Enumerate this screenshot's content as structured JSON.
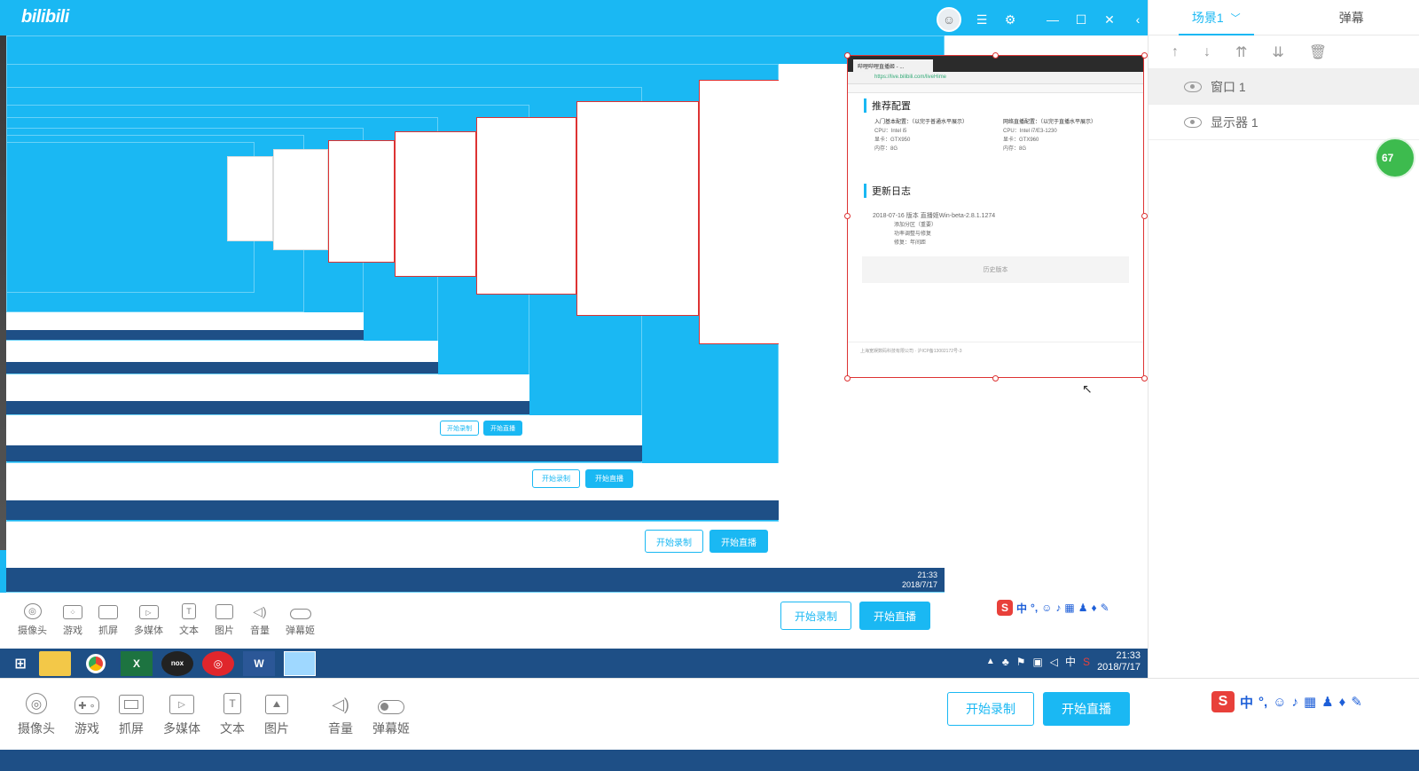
{
  "app": {
    "logo": "bilibili"
  },
  "titlebar": {
    "icons": [
      "avatar-icon",
      "menu-icon",
      "settings-icon",
      "minimize-icon",
      "maximize-icon",
      "close-icon",
      "collapse-icon"
    ]
  },
  "right_panel": {
    "tabs": [
      {
        "label": "场景1"
      },
      {
        "label": "弹幕"
      }
    ],
    "tools": [
      "move-up-icon",
      "move-down-icon",
      "move-top-icon",
      "move-bottom-icon",
      "delete-icon"
    ],
    "sources": [
      {
        "label": "窗口 1"
      },
      {
        "label": "显示器 1"
      }
    ],
    "badge": "67"
  },
  "toolbar": {
    "sources": [
      {
        "label": "摄像头",
        "icon": "camera-icon"
      },
      {
        "label": "游戏",
        "icon": "gamepad-icon"
      },
      {
        "label": "抓屏",
        "icon": "screen-capture-icon"
      },
      {
        "label": "多媒体",
        "icon": "media-icon"
      },
      {
        "label": "文本",
        "icon": "text-icon"
      },
      {
        "label": "图片",
        "icon": "image-icon"
      },
      {
        "label": "音量",
        "icon": "volume-icon"
      },
      {
        "label": "弹幕姬",
        "icon": "danmaku-toggle-icon"
      }
    ],
    "record_label": "开始录制",
    "live_label": "开始直播"
  },
  "nested_taskbar": {
    "time": "21:33",
    "date": "2018/7/17",
    "ime_lang": "中"
  },
  "browser_capture": {
    "tab_title": "哔哩哔哩直播姬 - ...",
    "url": "https://live.bilibili.com/liveHime",
    "section1": "推荐配置",
    "entry_label": "入门基本配置：（以完于普通水平展示）",
    "pro_label": "网络直播配置：（以完于直播水平展示）",
    "spec_left": [
      "CPU：Intel i5",
      "显卡：GTX950",
      "内存：8G"
    ],
    "spec_right": [
      "CPU：Intel i7/E3-1230",
      "显卡：GTX960",
      "内存：8G"
    ],
    "section2": "更新日志",
    "log_line": "2018-07-16 版本 直播姬Win-beta-2.8.1.1274",
    "log_items": [
      "添加分区（重要）",
      "功率调整与修复",
      "修复：年间距"
    ],
    "more_btn": "历史版本",
    "footer": "上海宽娱数码科技有限公司 · 沪ICP备13002172号-3"
  }
}
